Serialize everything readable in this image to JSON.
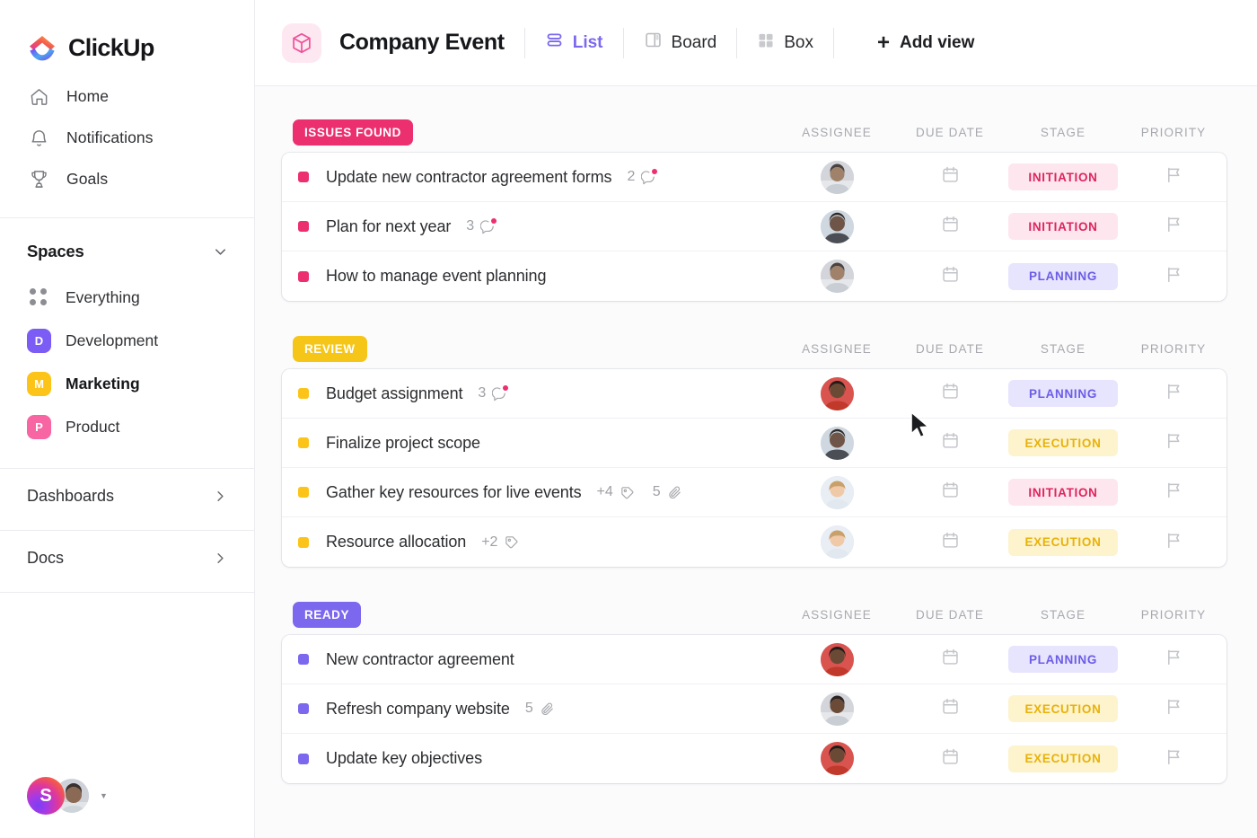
{
  "brand": {
    "name": "ClickUp",
    "logo_icon": "clickup-logo-icon"
  },
  "sidebar": {
    "nav": [
      {
        "label": "Home",
        "icon": "home-icon"
      },
      {
        "label": "Notifications",
        "icon": "bell-icon"
      },
      {
        "label": "Goals",
        "icon": "trophy-icon"
      }
    ],
    "spaces": {
      "title": "Spaces",
      "collapse_icon": "chevron-down-icon",
      "items": [
        {
          "label": "Everything",
          "icon": "grid-dots-icon",
          "initial": "",
          "color": "",
          "active": false
        },
        {
          "label": "Development",
          "icon": "space-badge",
          "initial": "D",
          "color": "#7b5cf5",
          "active": false
        },
        {
          "label": "Marketing",
          "icon": "space-badge",
          "initial": "M",
          "color": "#fcc419",
          "active": true
        },
        {
          "label": "Product",
          "icon": "space-badge",
          "initial": "P",
          "color": "#f765a3",
          "active": false
        }
      ]
    },
    "sections": [
      {
        "label": "Dashboards",
        "icon": "chevron-right-icon"
      },
      {
        "label": "Docs",
        "icon": "chevron-right-icon"
      }
    ],
    "user_bar": {
      "workspace_initial": "S",
      "workspace_icon": "workspace-avatar",
      "user_icon": "user-avatar",
      "caret_icon": "caret-down-icon"
    }
  },
  "header": {
    "list_icon": "cube-box-icon",
    "title": "Company Event",
    "views": [
      {
        "label": "List",
        "icon": "list-view-icon",
        "active": true
      },
      {
        "label": "Board",
        "icon": "board-view-icon",
        "active": false
      },
      {
        "label": "Box",
        "icon": "box-view-icon",
        "active": false
      }
    ],
    "add_view": {
      "label": "Add view",
      "icon": "plus-icon"
    }
  },
  "columns": [
    "ASSIGNEE",
    "DUE DATE",
    "STAGE",
    "PRIORITY"
  ],
  "colors": {
    "issues_found": "#ec2f6e",
    "review": "#f5c518",
    "ready": "#7b68ee",
    "initiation_bg": "#fde6ee",
    "initiation_fg": "#e0245e",
    "planning_bg": "#e7e4fd",
    "planning_fg": "#6c5ce7",
    "execution_bg": "#fdf3cd",
    "execution_fg": "#e8b20a"
  },
  "groups": [
    {
      "name": "ISSUES FOUND",
      "badge_color": "#ec2f6e",
      "dot_color": "#ec2f6e",
      "tasks": [
        {
          "name": "Update new contractor agreement forms",
          "comments": "2",
          "comment_icon": "comment-icon",
          "has_unread": true,
          "tags": "",
          "attachments": "",
          "assignee_icon": "avatar",
          "avatar_tone": "a1",
          "due_icon": "calendar-icon",
          "stage": "INITIATION",
          "stage_bg": "#fde6ee",
          "stage_fg": "#e0245e",
          "priority_icon": "flag-icon"
        },
        {
          "name": "Plan for next year",
          "comments": "3",
          "comment_icon": "comment-icon",
          "has_unread": true,
          "tags": "",
          "attachments": "",
          "assignee_icon": "avatar",
          "avatar_tone": "a2",
          "due_icon": "calendar-icon",
          "stage": "INITIATION",
          "stage_bg": "#fde6ee",
          "stage_fg": "#e0245e",
          "priority_icon": "flag-icon"
        },
        {
          "name": "How to manage event planning",
          "comments": "",
          "comment_icon": "",
          "has_unread": false,
          "tags": "",
          "attachments": "",
          "assignee_icon": "avatar",
          "avatar_tone": "a1",
          "due_icon": "calendar-icon",
          "stage": "PLANNING",
          "stage_bg": "#e7e4fd",
          "stage_fg": "#6c5ce7",
          "priority_icon": "flag-icon"
        }
      ]
    },
    {
      "name": "REVIEW",
      "badge_color": "#f5c518",
      "dot_color": "#fcc419",
      "tasks": [
        {
          "name": "Budget assignment",
          "comments": "3",
          "comment_icon": "comment-icon",
          "has_unread": true,
          "tags": "",
          "attachments": "",
          "assignee_icon": "avatar",
          "avatar_tone": "a3",
          "due_icon": "calendar-icon",
          "stage": "PLANNING",
          "stage_bg": "#e7e4fd",
          "stage_fg": "#6c5ce7",
          "priority_icon": "flag-icon"
        },
        {
          "name": "Finalize project scope",
          "comments": "",
          "comment_icon": "",
          "has_unread": false,
          "tags": "",
          "attachments": "",
          "assignee_icon": "avatar",
          "avatar_tone": "a2",
          "due_icon": "calendar-icon",
          "stage": "EXECUTION",
          "stage_bg": "#fdf3cd",
          "stage_fg": "#e8b20a",
          "priority_icon": "flag-icon"
        },
        {
          "name": "Gather key resources for live events",
          "comments": "",
          "comment_icon": "",
          "has_unread": false,
          "tags": "+4",
          "attachments": "5",
          "assignee_icon": "avatar",
          "avatar_tone": "a4",
          "due_icon": "calendar-icon",
          "stage": "INITIATION",
          "stage_bg": "#fde6ee",
          "stage_fg": "#e0245e",
          "priority_icon": "flag-icon"
        },
        {
          "name": "Resource allocation",
          "comments": "",
          "comment_icon": "",
          "has_unread": false,
          "tags": "+2",
          "attachments": "",
          "assignee_icon": "avatar",
          "avatar_tone": "a4",
          "due_icon": "calendar-icon",
          "stage": "EXECUTION",
          "stage_bg": "#fdf3cd",
          "stage_fg": "#e8b20a",
          "priority_icon": "flag-icon"
        }
      ]
    },
    {
      "name": "READY",
      "badge_color": "#7b68ee",
      "dot_color": "#7b68ee",
      "tasks": [
        {
          "name": "New contractor agreement",
          "comments": "",
          "comment_icon": "",
          "has_unread": false,
          "tags": "",
          "attachments": "",
          "assignee_icon": "avatar",
          "avatar_tone": "a3",
          "due_icon": "calendar-icon",
          "stage": "PLANNING",
          "stage_bg": "#e7e4fd",
          "stage_fg": "#6c5ce7",
          "priority_icon": "flag-icon"
        },
        {
          "name": "Refresh company website",
          "comments": "",
          "comment_icon": "",
          "has_unread": false,
          "tags": "",
          "attachments": "5",
          "assignee_icon": "avatar",
          "avatar_tone": "a1",
          "due_icon": "calendar-icon",
          "stage": "EXECUTION",
          "stage_bg": "#fdf3cd",
          "stage_fg": "#e8b20a",
          "priority_icon": "flag-icon"
        },
        {
          "name": "Update key objectives",
          "comments": "",
          "comment_icon": "",
          "has_unread": false,
          "tags": "",
          "attachments": "",
          "assignee_icon": "avatar",
          "avatar_tone": "a3",
          "due_icon": "calendar-icon",
          "stage": "EXECUTION",
          "stage_bg": "#fdf3cd",
          "stage_fg": "#e8b20a",
          "priority_icon": "flag-icon"
        }
      ]
    }
  ]
}
